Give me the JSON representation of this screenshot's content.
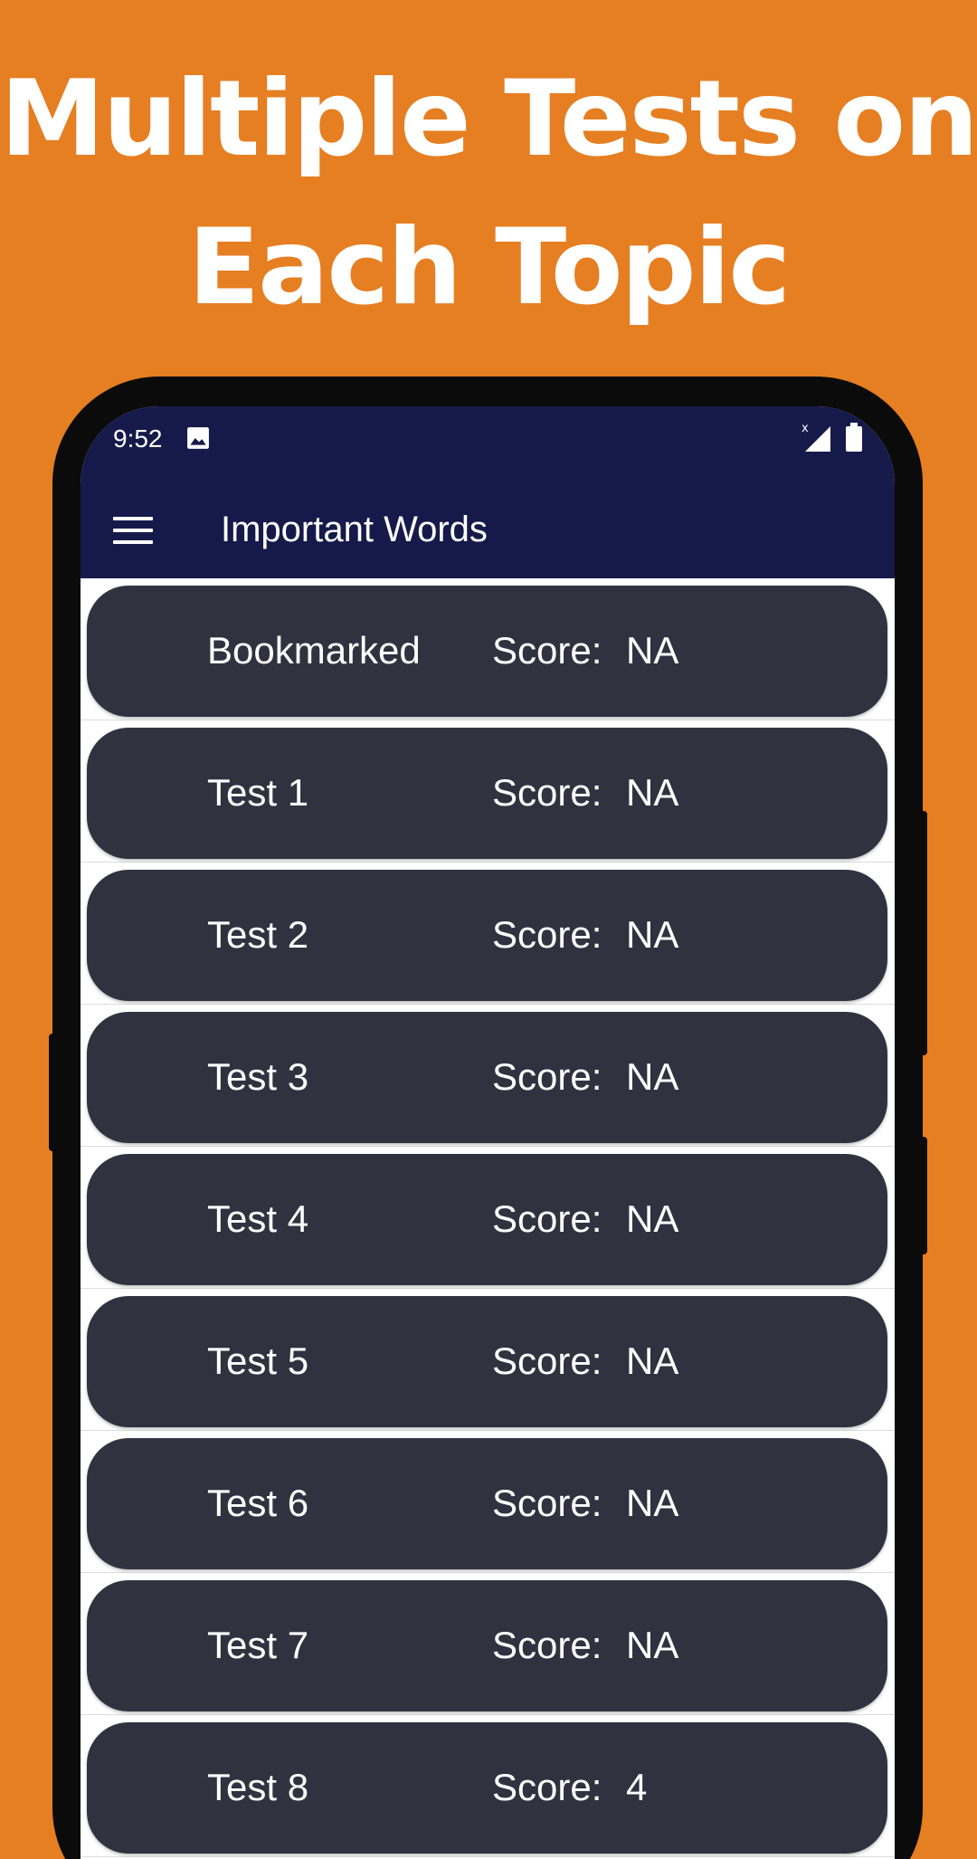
{
  "headline": {
    "line1": "Multiple Tests on",
    "line2": "Each Topic"
  },
  "status_bar": {
    "time": "9:52",
    "icons": [
      "image-icon",
      "signal-icon",
      "battery-icon"
    ]
  },
  "app_bar": {
    "title": "Important Words",
    "menu_icon": "menu-icon"
  },
  "tests": [
    {
      "name": "Bookmarked",
      "score_label": "Score:",
      "score": "NA"
    },
    {
      "name": "Test 1",
      "score_label": "Score:",
      "score": "NA"
    },
    {
      "name": "Test 2",
      "score_label": "Score:",
      "score": "NA"
    },
    {
      "name": "Test 3",
      "score_label": "Score:",
      "score": "NA"
    },
    {
      "name": "Test 4",
      "score_label": "Score:",
      "score": "NA"
    },
    {
      "name": "Test 5",
      "score_label": "Score:",
      "score": "NA"
    },
    {
      "name": "Test 6",
      "score_label": "Score:",
      "score": "NA"
    },
    {
      "name": "Test 7",
      "score_label": "Score:",
      "score": "NA"
    },
    {
      "name": "Test 8",
      "score_label": "Score:",
      "score": "4"
    }
  ],
  "colors": {
    "background": "#E67E22",
    "app_bar": "#161A4A",
    "card": "#30323F",
    "text": "#FFFFFF"
  }
}
